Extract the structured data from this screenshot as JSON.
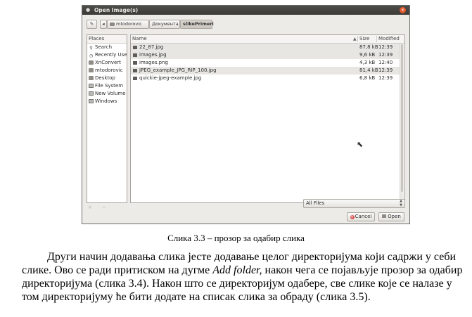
{
  "dialog": {
    "title": "Open Image(s)",
    "path": [
      "mtodorovic",
      "Документа",
      "slikePrimeri"
    ],
    "places": {
      "header": "Places",
      "items": [
        {
          "label": "Search",
          "icon": "search-icon"
        },
        {
          "label": "Recently Used",
          "icon": "clock-icon"
        },
        {
          "label": "XnConvert",
          "icon": "folder-icon"
        },
        {
          "label": "mtodorovic",
          "icon": "home-folder-icon"
        },
        {
          "label": "Desktop",
          "icon": "desktop-folder-icon"
        },
        {
          "label": "File System",
          "icon": "drive-icon"
        },
        {
          "label": "New Volume",
          "icon": "drive-icon"
        },
        {
          "label": "Windows",
          "icon": "drive-icon"
        }
      ]
    },
    "files": {
      "columns": {
        "name": "Name",
        "size": "Size",
        "modified": "Modified"
      },
      "rows": [
        {
          "name": "22_87.jpg",
          "size": "87,8 kB",
          "modified": "12:39"
        },
        {
          "name": "images.jpg",
          "size": "9,6 kB",
          "modified": "12:39"
        },
        {
          "name": "images.png",
          "size": "4,3 kB",
          "modified": "12:40"
        },
        {
          "name": "JPEG_example_JPG_RIP_100.jpg",
          "size": "81,4 kB",
          "modified": "12:39"
        },
        {
          "name": "quickie-jpeg-example.jpg",
          "size": "6,8 kB",
          "modified": "12:39"
        }
      ]
    },
    "filter": "All Files",
    "buttons": {
      "cancel": "Cancel",
      "open": "Open"
    },
    "places_controls": "+ −"
  },
  "caption": "Слика 3.3 – прозор за одабир слика",
  "paragraph": {
    "part1": "Други начин додавања слика јесте додавање целог директоријума који садржи у себи слике. Ово се ради притиском на дугме ",
    "emph": "Add folder,",
    "part2": " након чега се појављује прозор за одабир директоријума (слика 3.4). Након што се директоријум одабере, све слике које се налазе у том директоријуму ће бити додате на списак слика за обраду (слика 3.5)."
  }
}
